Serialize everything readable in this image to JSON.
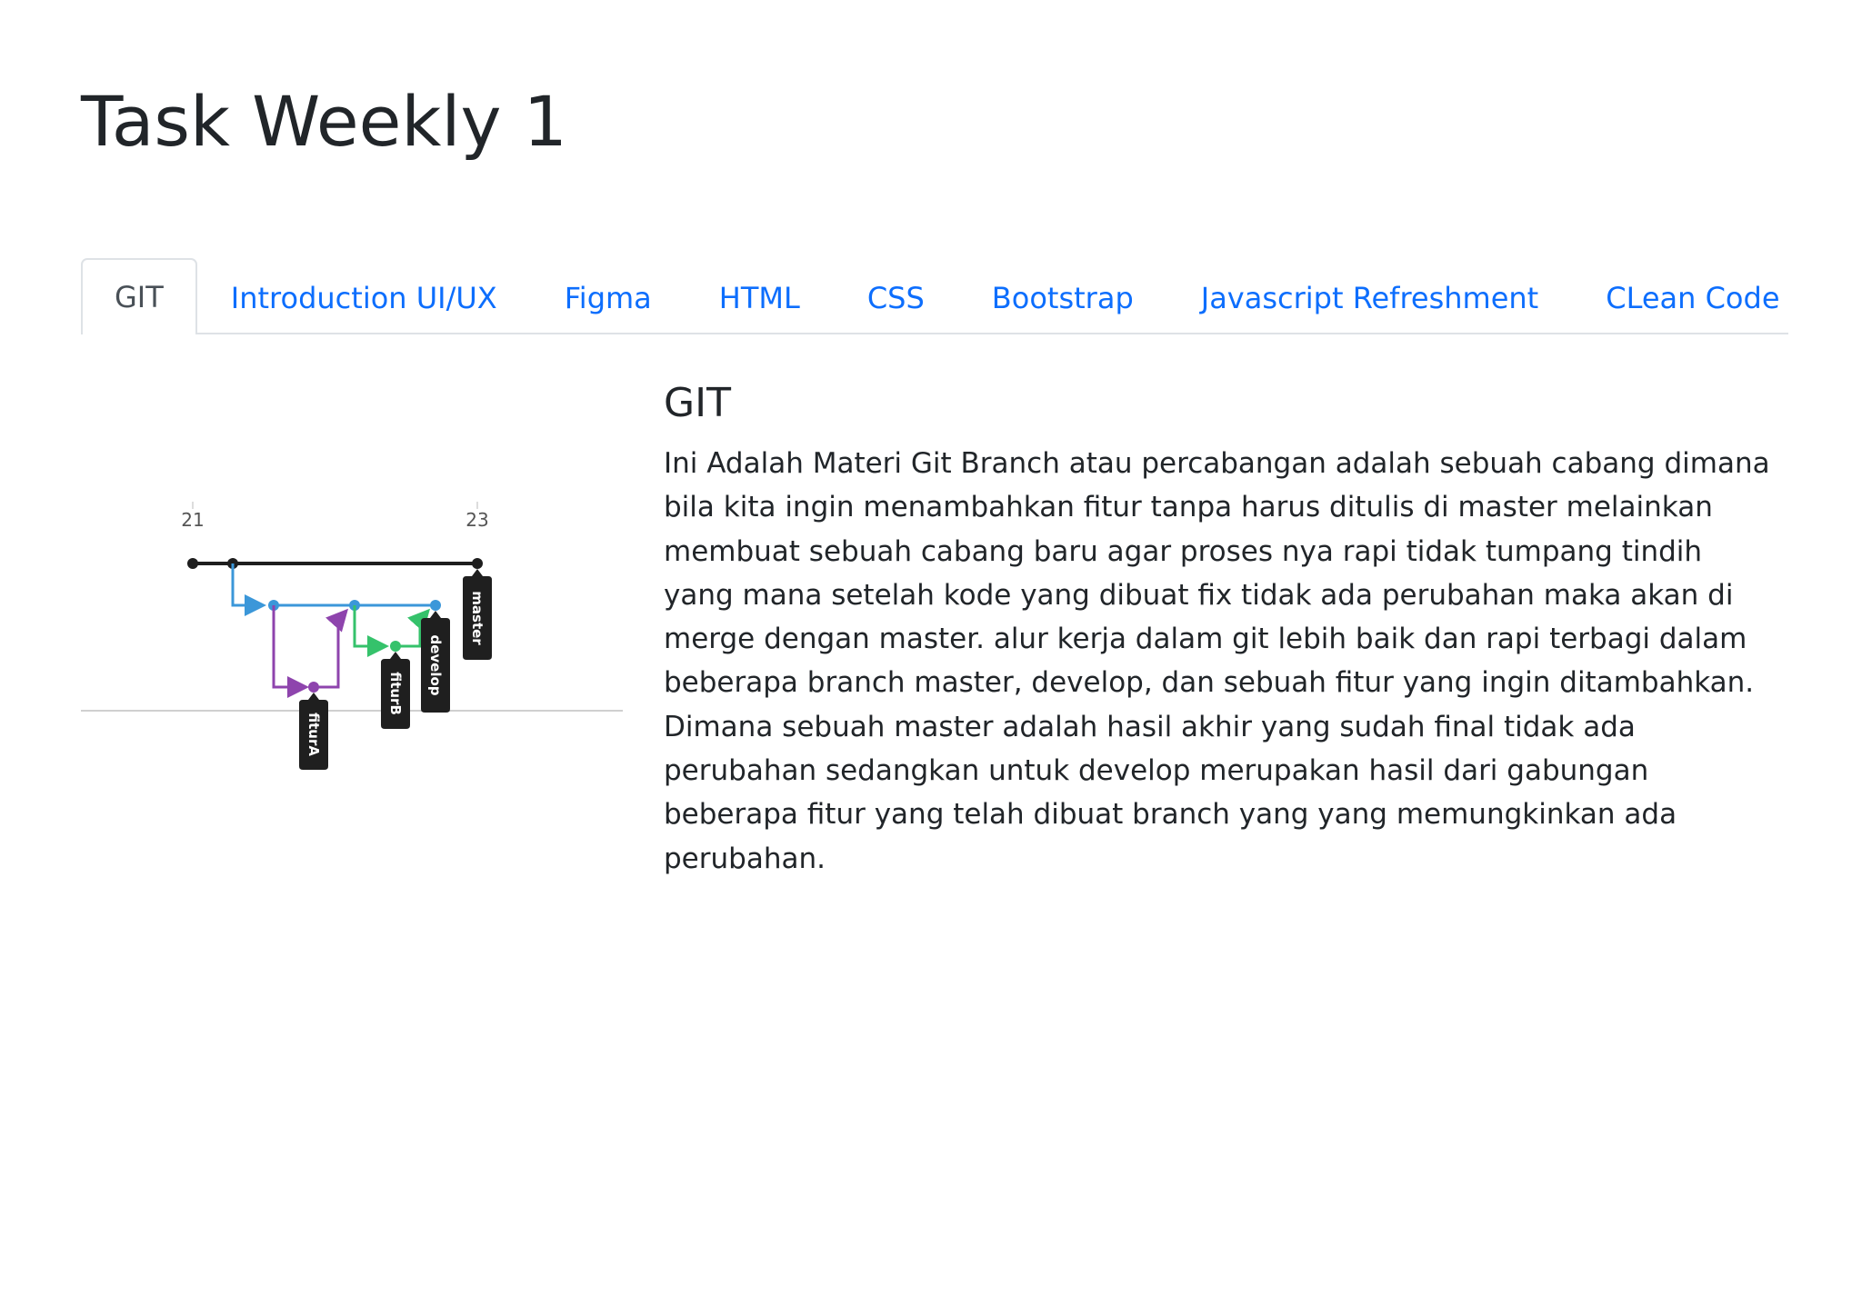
{
  "page": {
    "title": "Task Weekly 1"
  },
  "tabs": [
    {
      "label": "GIT",
      "active": true
    },
    {
      "label": "Introduction UI/UX",
      "active": false
    },
    {
      "label": "Figma",
      "active": false
    },
    {
      "label": "HTML",
      "active": false
    },
    {
      "label": "CSS",
      "active": false
    },
    {
      "label": "Bootstrap",
      "active": false
    },
    {
      "label": "Javascript Refreshment",
      "active": false
    },
    {
      "label": "CLean Code",
      "active": false
    }
  ],
  "content": {
    "heading": "GIT",
    "body": "Ini Adalah Materi Git Branch atau percabangan adalah sebuah cabang dimana bila kita ingin menambahkan fitur tanpa harus ditulis di master melainkan membuat sebuah cabang baru agar proses nya rapi tidak tumpang tindih yang mana setelah kode yang dibuat fix tidak ada perubahan maka akan di merge dengan master. alur kerja dalam git lebih baik dan rapi terbagi dalam beberapa branch master, develop, dan sebuah fitur yang ingin ditambahkan. Dimana sebuah master adalah hasil akhir yang sudah final tidak ada perubahan sedangkan untuk develop merupakan hasil dari gabungan beberapa fitur yang telah dibuat branch yang yang memungkinkan ada perubahan.",
    "diagram": {
      "tick_left": "21",
      "tick_right": "23",
      "branches": [
        "master",
        "develop",
        "fiturB",
        "fiturA"
      ],
      "colors": {
        "master": "#1e1e1e",
        "develop": "#3b97d9",
        "fiturB": "#35c26b",
        "fiturA": "#8e44ad",
        "tag_bg": "#1f1f1f",
        "axis": "#d0d0d0"
      }
    }
  },
  "colors": {
    "link": "#0d6efd",
    "active_tab_text": "#495057",
    "border": "#dee2e6",
    "text": "#212529"
  }
}
